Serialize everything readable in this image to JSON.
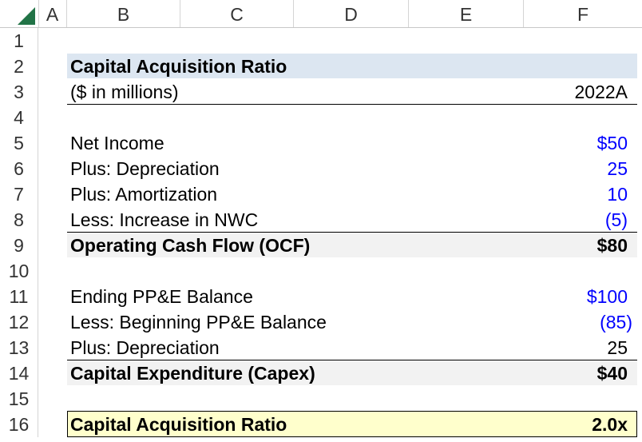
{
  "columns": [
    "A",
    "B",
    "C",
    "D",
    "E",
    "F"
  ],
  "rows": [
    "1",
    "2",
    "3",
    "4",
    "5",
    "6",
    "7",
    "8",
    "9",
    "10",
    "11",
    "12",
    "13",
    "14",
    "15",
    "16"
  ],
  "header": {
    "title": "Capital Acquisition Ratio",
    "units": "($ in millions)",
    "year": "2022A"
  },
  "ocf_section": {
    "items": [
      {
        "label": "Net Income",
        "value": "$50"
      },
      {
        "label": "Plus: Depreciation",
        "value": "25"
      },
      {
        "label": "Plus: Amortization",
        "value": "10"
      },
      {
        "label": "Less: Increase in NWC",
        "value": "(5)"
      }
    ],
    "total_label": "Operating Cash Flow (OCF)",
    "total_value": "$80"
  },
  "capex_section": {
    "items": [
      {
        "label": "Ending PP&E Balance",
        "value": "$100"
      },
      {
        "label": "Less: Beginning PP&E Balance",
        "value": "(85)"
      },
      {
        "label": "Plus: Depreciation",
        "value": "25"
      }
    ],
    "total_label": "Capital Expenditure (Capex)",
    "total_value": "$40"
  },
  "ratio": {
    "label": "Capital Acquisition Ratio",
    "value": "2.0x"
  },
  "colors": {
    "input_blue": "#0000ff",
    "title_band": "#dce6f1",
    "total_band": "#f2f2f2",
    "ratio_band": "#ffffcc",
    "excel_green": "#217346"
  }
}
